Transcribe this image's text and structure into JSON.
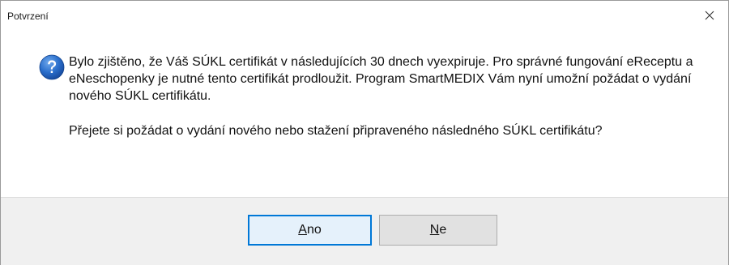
{
  "window": {
    "title": "Potvrzení",
    "close_icon": "close-icon"
  },
  "message": {
    "icon": "question-icon",
    "icon_color": "#1e63b8",
    "paragraph1": "Bylo zjištěno, že Váš SÚKL certifikát v následujících 30 dnech vyexpiruje. Pro správné fungování eReceptu a eNeschopenky je nutné tento certifikát prodloužit. Program SmartMEDIX Vám nyní umožní požádat o vydání nového SÚKL certifikátu.",
    "paragraph2": "Přejete si požádat o vydání nového nebo stažení připraveného následného SÚKL certifikátu?"
  },
  "buttons": {
    "yes": {
      "accel": "A",
      "rest": "no"
    },
    "no": {
      "accel": "N",
      "rest": "e"
    },
    "focus_color": "#0078d7"
  }
}
